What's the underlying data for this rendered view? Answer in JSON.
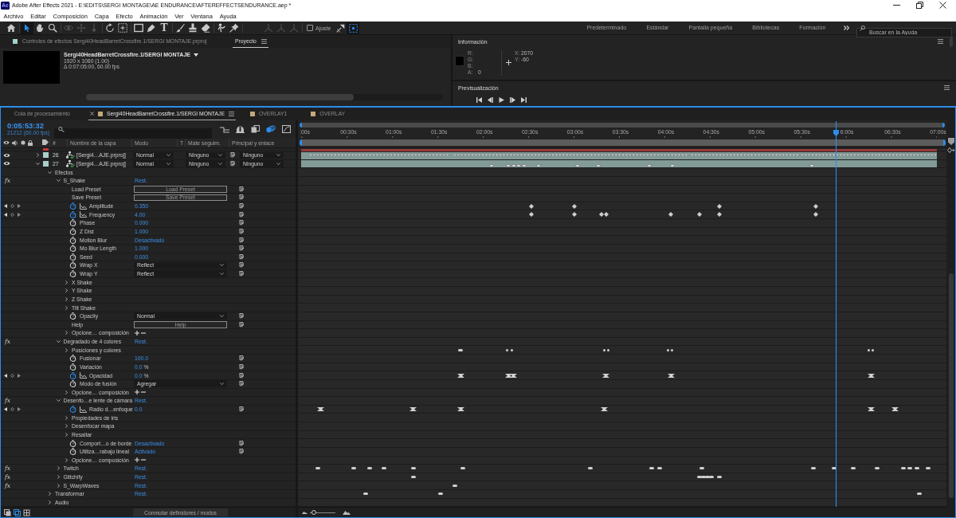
{
  "window": {
    "app_icon": "Ae",
    "title": "Adobe After Effects 2021 - E:\\EDITS\\SERGI MONTAGE\\AE ENDURANCE\\AFTEREFFECTSENDURANCE.aep *"
  },
  "menu": [
    "Archivo",
    "Editar",
    "Composición",
    "Capa",
    "Efecto",
    "Animación",
    "Ver",
    "Ventana",
    "Ayuda"
  ],
  "toolbar": {
    "tool_groups": [
      [
        {
          "kind": "home",
          "selected": false,
          "disabled": false
        }
      ],
      [
        {
          "kind": "selection",
          "selected": true,
          "disabled": false
        },
        {
          "kind": "hand",
          "selected": false,
          "disabled": false
        },
        {
          "kind": "zoom",
          "selected": false,
          "disabled": false
        }
      ],
      [
        {
          "kind": "orbit",
          "selected": false,
          "disabled": true
        },
        {
          "kind": "pan",
          "selected": false,
          "disabled": true
        },
        {
          "kind": "dolly",
          "selected": false,
          "disabled": true
        }
      ],
      [
        {
          "kind": "rotate",
          "selected": false,
          "disabled": false
        },
        {
          "kind": "anchor",
          "selected": false,
          "disabled": false
        }
      ],
      [
        {
          "kind": "shape",
          "selected": false,
          "disabled": false
        },
        {
          "kind": "pen",
          "selected": false,
          "disabled": false
        },
        {
          "kind": "type",
          "glyph": "T",
          "selected": false,
          "disabled": false
        }
      ],
      [
        {
          "kind": "brush",
          "selected": false,
          "disabled": false
        },
        {
          "kind": "stamp",
          "selected": false,
          "disabled": false
        },
        {
          "kind": "eraser",
          "selected": false,
          "disabled": false
        }
      ],
      [
        {
          "kind": "roto",
          "selected": false,
          "disabled": false
        },
        {
          "kind": "pin",
          "selected": false,
          "disabled": false
        }
      ],
      [
        {
          "kind": "axis",
          "selected": false,
          "disabled": true
        },
        {
          "kind": "axis",
          "selected": false,
          "disabled": true
        },
        {
          "kind": "axis",
          "selected": false,
          "disabled": true
        }
      ]
    ],
    "snap": {
      "label": "Ajuste",
      "checked": false
    },
    "snap_tools": [
      {
        "kind": "snap",
        "selected": false
      },
      {
        "kind": "target",
        "selected": true
      }
    ],
    "workspaces": [
      {
        "label": "Predeterminado",
        "selected": false
      },
      {
        "label": "Estándar",
        "selected": false
      },
      {
        "label": "Pantalla pequeña",
        "selected": false
      },
      {
        "label": "Bibliotecas",
        "selected": false
      },
      {
        "label": "Formación",
        "selected": false
      }
    ],
    "search": {
      "placeholder": "Buscar en la Ayuda"
    }
  },
  "project_panel": {
    "tabs": [
      {
        "kind": "effect-controls",
        "label": "Controles de efectos Sergi40HeadBarretCrossfire.1/SERGI MONTAJE.prproj",
        "selected": false
      },
      {
        "kind": "project",
        "label": "Proyecto",
        "selected": true
      }
    ],
    "item": {
      "name": "Sergi40HeadBarretCrossfire.1/SERGI MONTAJE",
      "details": [
        "1920 x 1080 (1.00)",
        "Δ 0:07:05:00, 60.00 fps"
      ]
    }
  },
  "info_panel": {
    "title": "Información",
    "channels": [
      {
        "label": "R:"
      },
      {
        "label": "G:"
      },
      {
        "label": "B:"
      },
      {
        "label": "A:",
        "value": "0"
      }
    ],
    "coordinates": [
      {
        "label": "X:",
        "value": "2070"
      },
      {
        "label": "Y:",
        "value": "-60"
      }
    ]
  },
  "preview_panel": {
    "title": "Previsualización"
  },
  "timeline": {
    "tabs": [
      {
        "kind": "queue",
        "label": "Cola de procesamiento",
        "selected": false
      },
      {
        "kind": "composition",
        "label": "Sergi40HeadBarretCrossfire.1/SERGI MONTAJE",
        "selected": true
      },
      {
        "kind": "composition",
        "label": "OVERLAY1",
        "selected": false
      },
      {
        "kind": "composition",
        "label": "OVERLAY",
        "selected": false
      }
    ],
    "timecode": "0:05:53:32",
    "frame_info": "21212 (60.00 fps)",
    "columns": [
      "#",
      "Nombre de la capa",
      "Modo",
      "T",
      "Mate seguim.",
      "Principal y enlace"
    ],
    "ruler": [
      ":00s",
      "00:30s",
      "01:00s",
      "01:30s",
      "02:00s",
      "02:30s",
      "03:00s",
      "03:30s",
      "04:00s",
      "04:30s",
      "05:00s",
      "05:30s",
      "6:00s",
      "06:30s",
      "07:00s"
    ],
    "layers": [
      {
        "kind": "clipped",
        "color": "#c8383a"
      },
      {
        "kind": "layer",
        "number": "26",
        "name": "[Sergi4…AJE.prproj]",
        "color": "#a9cfc9",
        "visible": true,
        "expanded": false,
        "mode": "Normal",
        "track_matte": "Ninguno",
        "parent": "Ninguno"
      },
      {
        "kind": "layer",
        "number": "27",
        "name": "[Sergi4…AJE.prproj]",
        "color": "#a9cfc9",
        "visible": true,
        "expanded": true,
        "mode": "Normal",
        "track_matte": "Ninguno",
        "parent": "Ninguno",
        "children": [
          {
            "kind": "group",
            "label": "Efectos",
            "expanded": true,
            "children": [
              {
                "kind": "effect",
                "fx": "fx",
                "enabled": true,
                "label": "S_Shake",
                "value": "Rest.",
                "expanded": true,
                "children": [
                  {
                    "kind": "button",
                    "label": "Load Preset",
                    "value": "Load Preset"
                  },
                  {
                    "kind": "button",
                    "label": "Save Preset",
                    "value": "Save Preset"
                  },
                  {
                    "kind": "property",
                    "label": "Amplitude",
                    "value": "0.350",
                    "animated": true
                  },
                  {
                    "kind": "property",
                    "label": "Frequency",
                    "value": "4.00",
                    "animated": true
                  },
                  {
                    "kind": "property",
                    "label": "Phase",
                    "value": "0.000",
                    "animated": false
                  },
                  {
                    "kind": "property",
                    "label": "Z Dist",
                    "value": "1.000",
                    "animated": false
                  },
                  {
                    "kind": "property",
                    "label": "Motion Blur",
                    "value": "Desactivado",
                    "animated": false
                  },
                  {
                    "kind": "property",
                    "label": "Mo Blur Length",
                    "value": "1.000",
                    "animated": false
                  },
                  {
                    "kind": "property",
                    "label": "Seed",
                    "value": "0.000",
                    "animated": false
                  },
                  {
                    "kind": "dropdown",
                    "label": "Wrap X",
                    "value": "Reflect",
                    "animated": false
                  },
                  {
                    "kind": "dropdown",
                    "label": "Wrap Y",
                    "value": "Reflect",
                    "animated": false
                  },
                  {
                    "kind": "group",
                    "label": "X Shake",
                    "expanded": false
                  },
                  {
                    "kind": "group",
                    "label": "Y Shake",
                    "expanded": false
                  },
                  {
                    "kind": "group",
                    "label": "Z Shake",
                    "expanded": false
                  },
                  {
                    "kind": "group",
                    "label": "Tilt Shake",
                    "expanded": false
                  },
                  {
                    "kind": "dropdown",
                    "label": "Opacity",
                    "value": "Normal",
                    "animated": false
                  },
                  {
                    "kind": "button",
                    "label": "Help",
                    "value": "Help"
                  },
                  {
                    "kind": "options",
                    "label": "Opcione… composición",
                    "expanded": false
                  }
                ]
              },
              {
                "kind": "effect",
                "fx": "fx",
                "enabled": true,
                "label": "Degradado de 4 colores",
                "value": "Rest.",
                "expanded": true,
                "children": [
                  {
                    "kind": "group",
                    "label": "Posiciones y colores",
                    "expanded": false
                  },
                  {
                    "kind": "property",
                    "label": "Fusionar",
                    "value": "100.0",
                    "animated": false
                  },
                  {
                    "kind": "property",
                    "label": "Variación",
                    "value": "0.0",
                    "unit": "%",
                    "animated": false
                  },
                  {
                    "kind": "property",
                    "label": "Opacidad",
                    "value": "0.0",
                    "unit": "%",
                    "animated": true
                  },
                  {
                    "kind": "dropdown",
                    "label": "Modo de fusión",
                    "value": "Agregar",
                    "animated": false
                  },
                  {
                    "kind": "options",
                    "label": "Opcione… composición",
                    "expanded": false
                  }
                ]
              },
              {
                "kind": "effect",
                "fx": "fx",
                "enabled": true,
                "label": "Desenfo…e lente de cámara",
                "value": "Rest.",
                "expanded": true,
                "children": [
                  {
                    "kind": "property",
                    "label": "Radio d…enfoque",
                    "value": "0.0",
                    "animated": true
                  },
                  {
                    "kind": "group",
                    "label": "Propiedades de iris",
                    "expanded": false
                  },
                  {
                    "kind": "group",
                    "label": "Desenfocar mapa",
                    "expanded": false
                  },
                  {
                    "kind": "group",
                    "label": "Resaltar",
                    "expanded": false
                  },
                  {
                    "kind": "property",
                    "label": "Comport…o de borde",
                    "value": "Desactivado",
                    "animated": false
                  },
                  {
                    "kind": "property",
                    "label": "Utiliza…rabajo lineal",
                    "value": "Activado",
                    "animated": false
                  },
                  {
                    "kind": "options",
                    "label": "Opcione… composición",
                    "expanded": false
                  }
                ]
              },
              {
                "kind": "effect",
                "fx": "fx",
                "enabled": true,
                "label": "Twitch",
                "value": "Rest.",
                "expanded": false
              },
              {
                "kind": "effect",
                "fx": "fx",
                "enabled": true,
                "label": "Glitchify",
                "value": "Rest.",
                "expanded": false
              },
              {
                "kind": "effect",
                "fx": "fx",
                "enabled": true,
                "label": "S_WarpWaves",
                "value": "Rest.",
                "expanded": false
              }
            ]
          },
          {
            "kind": "group",
            "label": "Transformar",
            "value": "Rest.",
            "expanded": false
          },
          {
            "kind": "group",
            "label": "Audio",
            "expanded": false
          }
        ]
      }
    ],
    "switch_button": "Conmutar definidores / modos",
    "zoom_slider": {
      "level": 0.1
    }
  }
}
